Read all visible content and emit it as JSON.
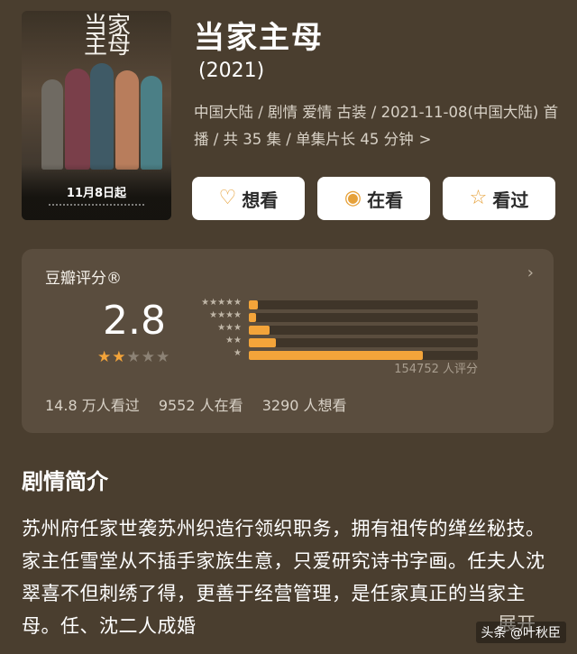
{
  "poster": {
    "calligraphy": "当家主母",
    "date_text": "11月8日起"
  },
  "title": "当家主母",
  "year": "(2021)",
  "meta": {
    "line": "中国大陆 / 剧情 爱情 古装 / 2021-11-08(中国大陆) 首播 / 共 35 集 / 单集片长 45 分钟",
    "chevron": ">"
  },
  "actions": {
    "want": {
      "label": "想看",
      "icon": "heart-plus-icon"
    },
    "watching": {
      "label": "在看",
      "icon": "target-circle-icon"
    },
    "watched": {
      "label": "看过",
      "icon": "star-icon"
    }
  },
  "rating": {
    "label": "豆瓣评分®",
    "score": "2.8",
    "stars": {
      "filled": 1,
      "half": 1,
      "total": 5
    },
    "distribution": [
      {
        "stars": "★★★★★",
        "fraction": 0.04
      },
      {
        "stars": "★★★★",
        "fraction": 0.03
      },
      {
        "stars": "★★★",
        "fraction": 0.09
      },
      {
        "stars": "★★",
        "fraction": 0.12
      },
      {
        "stars": "★",
        "fraction": 0.76
      }
    ],
    "votes": "154752 人评分",
    "stats": [
      "14.8 万人看过",
      "9552 人在看",
      "3290 人想看"
    ],
    "accent": "#f3a43a"
  },
  "synopsis": {
    "title": "剧情简介",
    "text": "苏州府任家世袭苏州织造行领织职务，拥有祖传的缂丝秘技。家主任雪堂从不插手家族生意，只爱研究诗书字画。任夫人沈翠喜不但刺绣了得，更善于经营管理，是任家真正的当家主母。任、沈二人成婚",
    "expand": "展开"
  },
  "watermark": "头条 @叶秋臣"
}
